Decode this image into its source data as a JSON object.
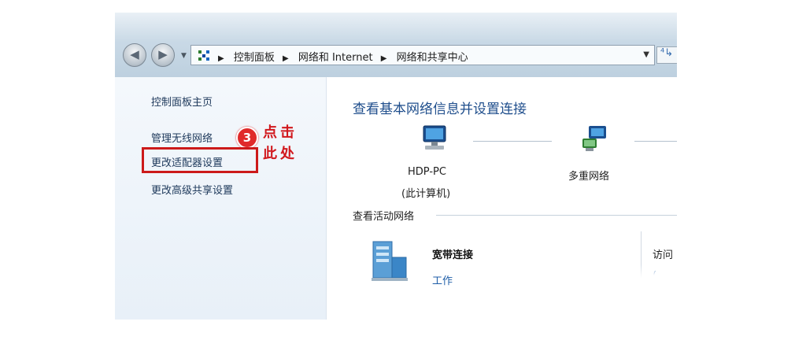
{
  "window": {
    "nav": {
      "back_icon": "back-arrow-icon",
      "forward_icon": "forward-arrow-icon",
      "dropdown_icon": "chevron-down-icon"
    },
    "address_bar": {
      "crumbs": [
        "控制面板",
        "网络和 Internet",
        "网络和共享中心"
      ],
      "separator_icon": "breadcrumb-arrow-icon",
      "refresh_glyph": "⁴↳"
    }
  },
  "left_pane": {
    "links": {
      "home": "控制面板主页",
      "wireless": "管理无线网络",
      "adapter": "更改适配器设置",
      "sharing": "更改高级共享设置"
    },
    "annotation": {
      "step": "3",
      "line1": "点击",
      "line2": "此处",
      "color": "#d1181d"
    }
  },
  "main": {
    "title": "查看基本网络信息并设置连接",
    "map": {
      "computer_name": "HDP-PC",
      "computer_sub": "(此计算机)",
      "network_name": "多重网络"
    },
    "active_section": "查看活动网络",
    "connection": {
      "name": "宽带连接",
      "type": "工作",
      "access_label": "访问",
      "access_value": "("
    }
  }
}
